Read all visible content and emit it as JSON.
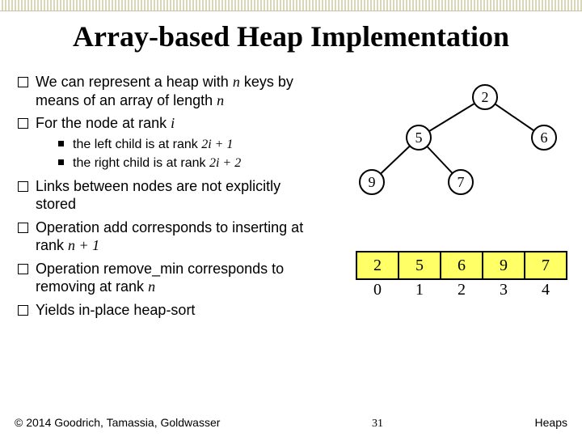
{
  "title": "Array-based Heap Implementation",
  "bullets": {
    "b0a": "We can represent a heap with ",
    "b0_n": "n",
    "b0b": " keys by means of an array of length ",
    "b0_n2": "n",
    "b1a": "For the node at rank ",
    "b1_i": "i",
    "s1a": "the left child is at rank ",
    "s1_f": "2i + 1",
    "s2a": "the right child is at rank ",
    "s2_f": "2i + 2",
    "b2": "Links between nodes are not explicitly stored",
    "b3a": "Operation add corresponds to inserting at rank ",
    "b3_f": "n + 1",
    "b4a": "Operation remove_min corresponds to removing at rank ",
    "b4_n": "n",
    "b5": "Yields in-place heap-sort"
  },
  "tree": {
    "n0": "2",
    "n1": "5",
    "n2": "6",
    "n3": "9",
    "n4": "7"
  },
  "array": {
    "v0": "2",
    "v1": "5",
    "v2": "6",
    "v3": "9",
    "v4": "7",
    "i0": "0",
    "i1": "1",
    "i2": "2",
    "i3": "3",
    "i4": "4"
  },
  "footer": {
    "copyright": "© 2014 Goodrich, Tamassia, Goldwasser",
    "page": "31",
    "section": "Heaps"
  }
}
